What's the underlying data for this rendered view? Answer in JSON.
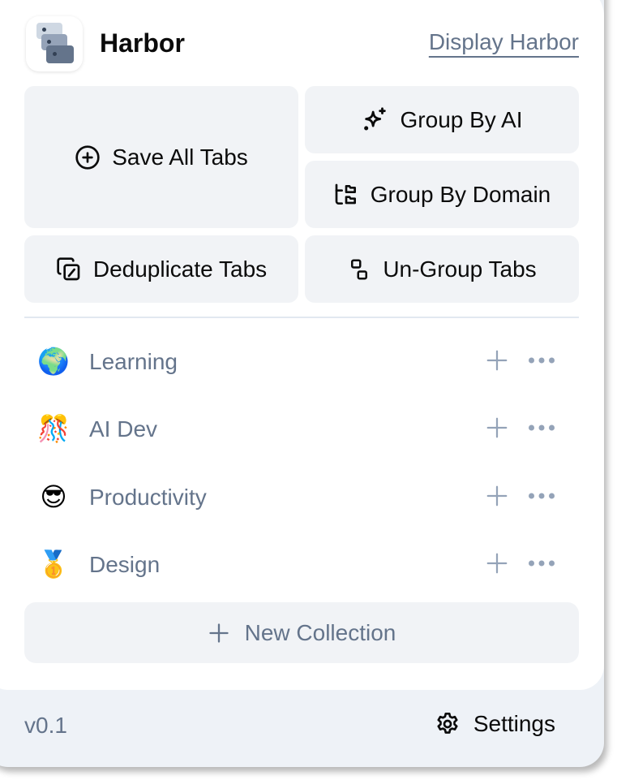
{
  "header": {
    "app_title": "Harbor",
    "logo_icon": "stacked-cards-logo",
    "display_link": "Display Harbor"
  },
  "actions": {
    "save_all_tabs": {
      "label": "Save All Tabs",
      "icon": "plus-circle-icon"
    },
    "group_by_ai": {
      "label": "Group By AI",
      "icon": "sparkles-icon"
    },
    "group_by_domain": {
      "label": "Group By Domain",
      "icon": "folder-tree-icon"
    },
    "deduplicate_tabs": {
      "label": "Deduplicate Tabs",
      "icon": "copy-slash-icon"
    },
    "ungroup_tabs": {
      "label": "Un-Group Tabs",
      "icon": "ungroup-icon"
    }
  },
  "collections": [
    {
      "emoji": "🌍",
      "name": "Learning"
    },
    {
      "emoji": "🎊",
      "name": "AI Dev"
    },
    {
      "emoji": "😎",
      "name": "Productivity"
    },
    {
      "emoji": "🥇",
      "name": "Design"
    }
  ],
  "new_collection": {
    "label": "New Collection",
    "icon": "plus-icon"
  },
  "footer": {
    "version": "v0.1",
    "settings_label": "Settings",
    "settings_icon": "gear-icon"
  },
  "colors": {
    "muted_text": "#64748b",
    "button_bg": "#f1f3f6",
    "footer_bg": "#eef2f7",
    "icon_gray": "#94a3b8"
  }
}
